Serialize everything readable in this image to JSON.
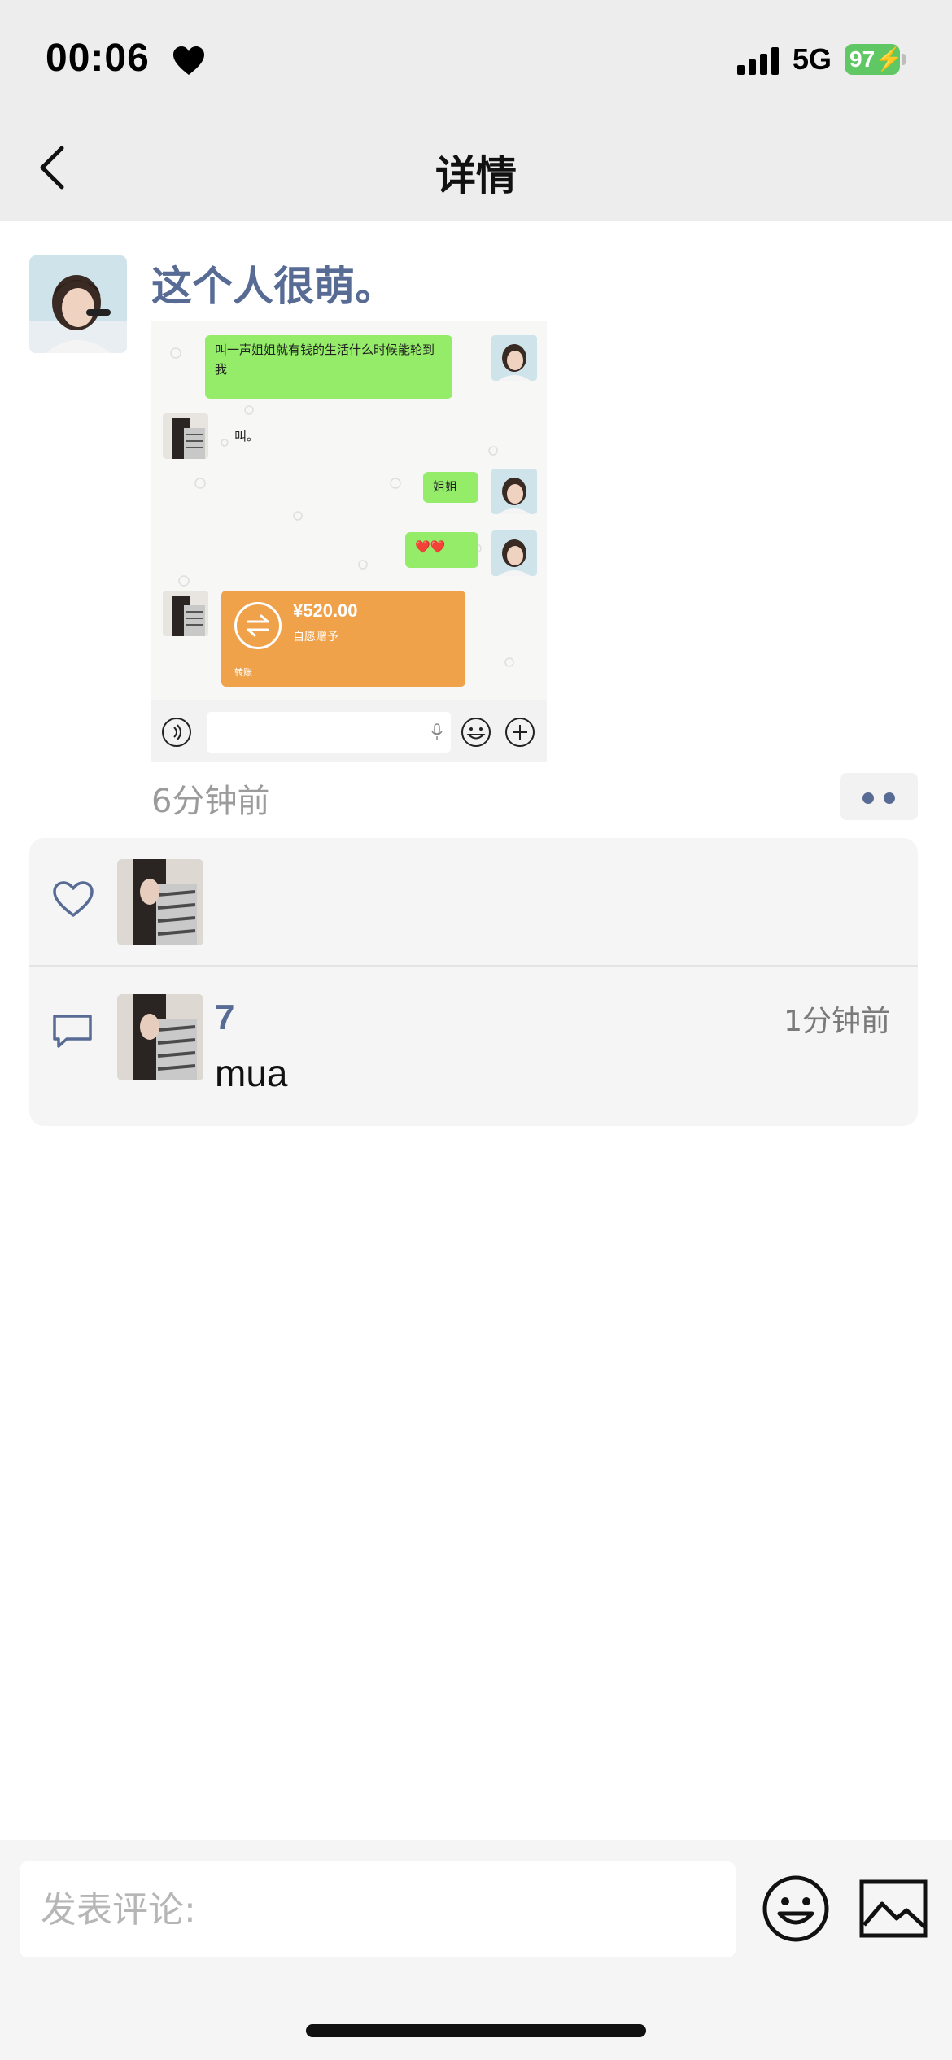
{
  "status_bar": {
    "time": "00:06",
    "network": "5G",
    "battery": "97"
  },
  "nav": {
    "title": "详情"
  },
  "post": {
    "author": "这个人很萌。",
    "time": "6分钟前",
    "image": {
      "chat_messages": [
        {
          "side": "right",
          "text": "叫一声姐姐就有钱的生活什么时候能轮到我"
        },
        {
          "side": "left",
          "text": "叫。"
        },
        {
          "side": "right",
          "text": "姐姐"
        },
        {
          "side": "right",
          "text": "❤️❤️"
        }
      ],
      "transfer": {
        "amount": "¥520.00",
        "note": "自愿赠予",
        "label": "转账"
      }
    }
  },
  "likes": {
    "count": 1
  },
  "comments": [
    {
      "name": "7",
      "time": "1分钟前",
      "text": "mua"
    }
  ],
  "bottom_bar": {
    "comment_placeholder": "发表评论:"
  },
  "colors": {
    "accent": "#576b95",
    "chat_green": "#95ec69",
    "transfer_orange": "#f0a24b",
    "battery_green": "#5fc864"
  }
}
